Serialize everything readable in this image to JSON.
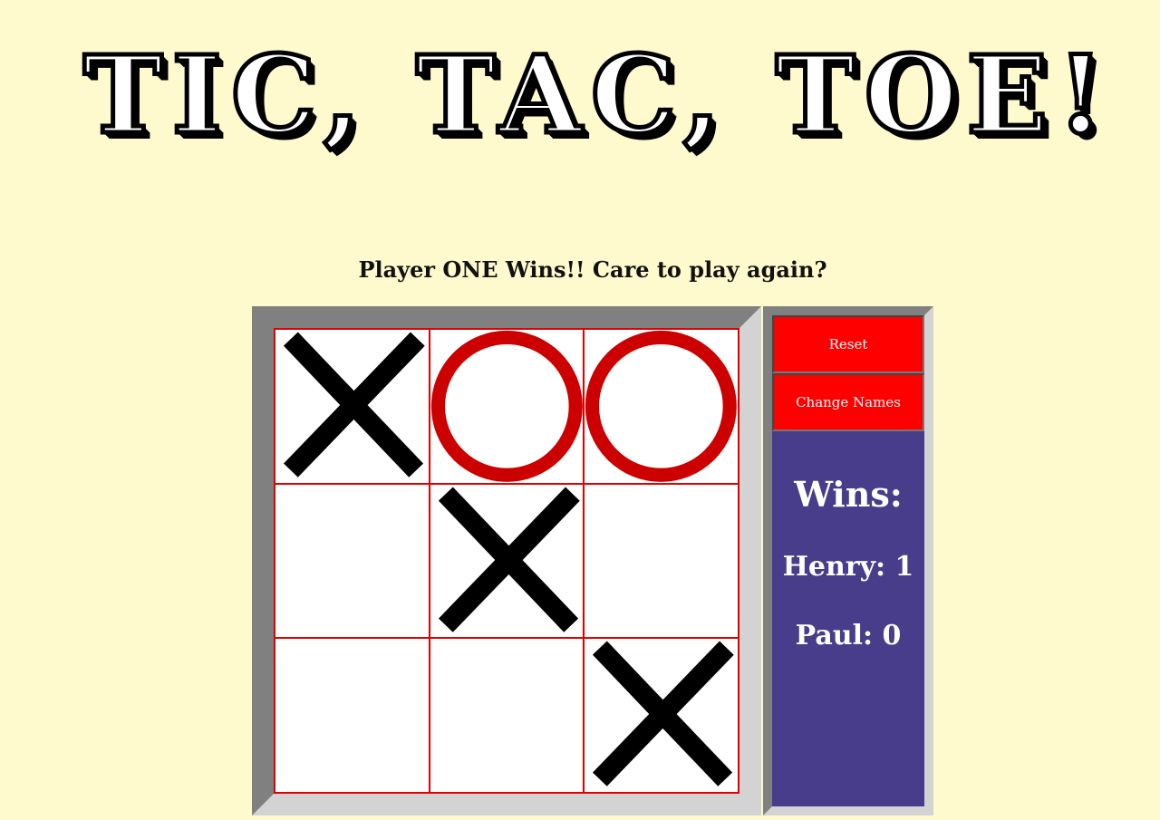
{
  "title": "TIC, TAC, TOE!",
  "status_message": "Player ONE Wins!! Care to play again?",
  "board": {
    "cells": [
      "X",
      "O",
      "O",
      "",
      "X",
      "",
      "",
      "",
      "X"
    ]
  },
  "controls": {
    "reset_label": "Reset",
    "change_names_label": "Change Names"
  },
  "scoreboard": {
    "heading": "Wins:",
    "players": [
      {
        "name": "Henry",
        "score": 1,
        "display": "Henry: 1"
      },
      {
        "name": "Paul",
        "score": 0,
        "display": "Paul: 0"
      }
    ]
  },
  "colors": {
    "background": "#fffacd",
    "grid_line": "#e00000",
    "o_mark": "#cc0000",
    "x_mark": "#000000",
    "button": "#ff0000",
    "panel": "#483d8b"
  },
  "icons": {
    "x_mark": "x-mark-icon",
    "o_mark": "o-mark-icon"
  }
}
